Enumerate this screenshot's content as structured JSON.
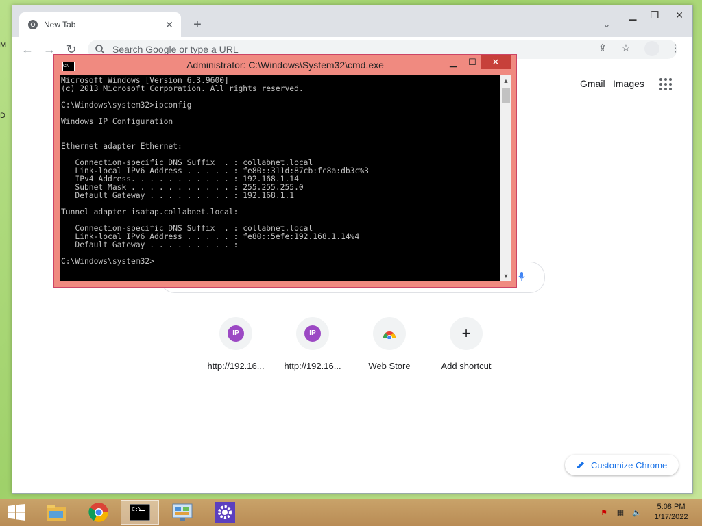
{
  "desktop": {
    "slivers": [
      "M",
      "D"
    ]
  },
  "chrome": {
    "tab_title": "New Tab",
    "omnibox_placeholder": "Search Google or type a URL",
    "links": {
      "gmail": "Gmail",
      "images": "Images"
    },
    "shortcuts": [
      {
        "label": "http://192.16...",
        "icon_text": "IP"
      },
      {
        "label": "http://192.16...",
        "icon_text": "IP"
      },
      {
        "label": "Web Store",
        "icon": "chrome-web-store-icon"
      },
      {
        "label": "Add shortcut",
        "icon": "plus-icon"
      }
    ],
    "customize_label": "Customize Chrome",
    "colors": {
      "accent": "#1a73e8",
      "ip_badge": "#9c49c4"
    }
  },
  "cmd": {
    "title": "Administrator: C:\\Windows\\System32\\cmd.exe",
    "output": "Microsoft Windows [Version 6.3.9600]\n(c) 2013 Microsoft Corporation. All rights reserved.\n\nC:\\Windows\\system32>ipconfig\n\nWindows IP Configuration\n\n\nEthernet adapter Ethernet:\n\n   Connection-specific DNS Suffix  . : collabnet.local\n   Link-local IPv6 Address . . . . . : fe80::311d:87cb:fc8a:db3c%3\n   IPv4 Address. . . . . . . . . . . : 192.168.1.14\n   Subnet Mask . . . . . . . . . . . : 255.255.255.0\n   Default Gateway . . . . . . . . . : 192.168.1.1\n\nTunnel adapter isatap.collabnet.local:\n\n   Connection-specific DNS Suffix  . : collabnet.local\n   Link-local IPv6 Address . . . . . : fe80::5efe:192.168.1.14%4\n   Default Gateway . . . . . . . . . :\n\nC:\\Windows\\system32>",
    "colors": {
      "frame": "#f08a80",
      "close": "#c7403a"
    }
  },
  "taskbar": {
    "apps": [
      "file-explorer-icon",
      "chrome-icon",
      "cmd-icon",
      "control-panel-icon",
      "settings-gear-icon"
    ],
    "clock_time": "5:08 PM",
    "clock_date": "1/17/2022"
  }
}
